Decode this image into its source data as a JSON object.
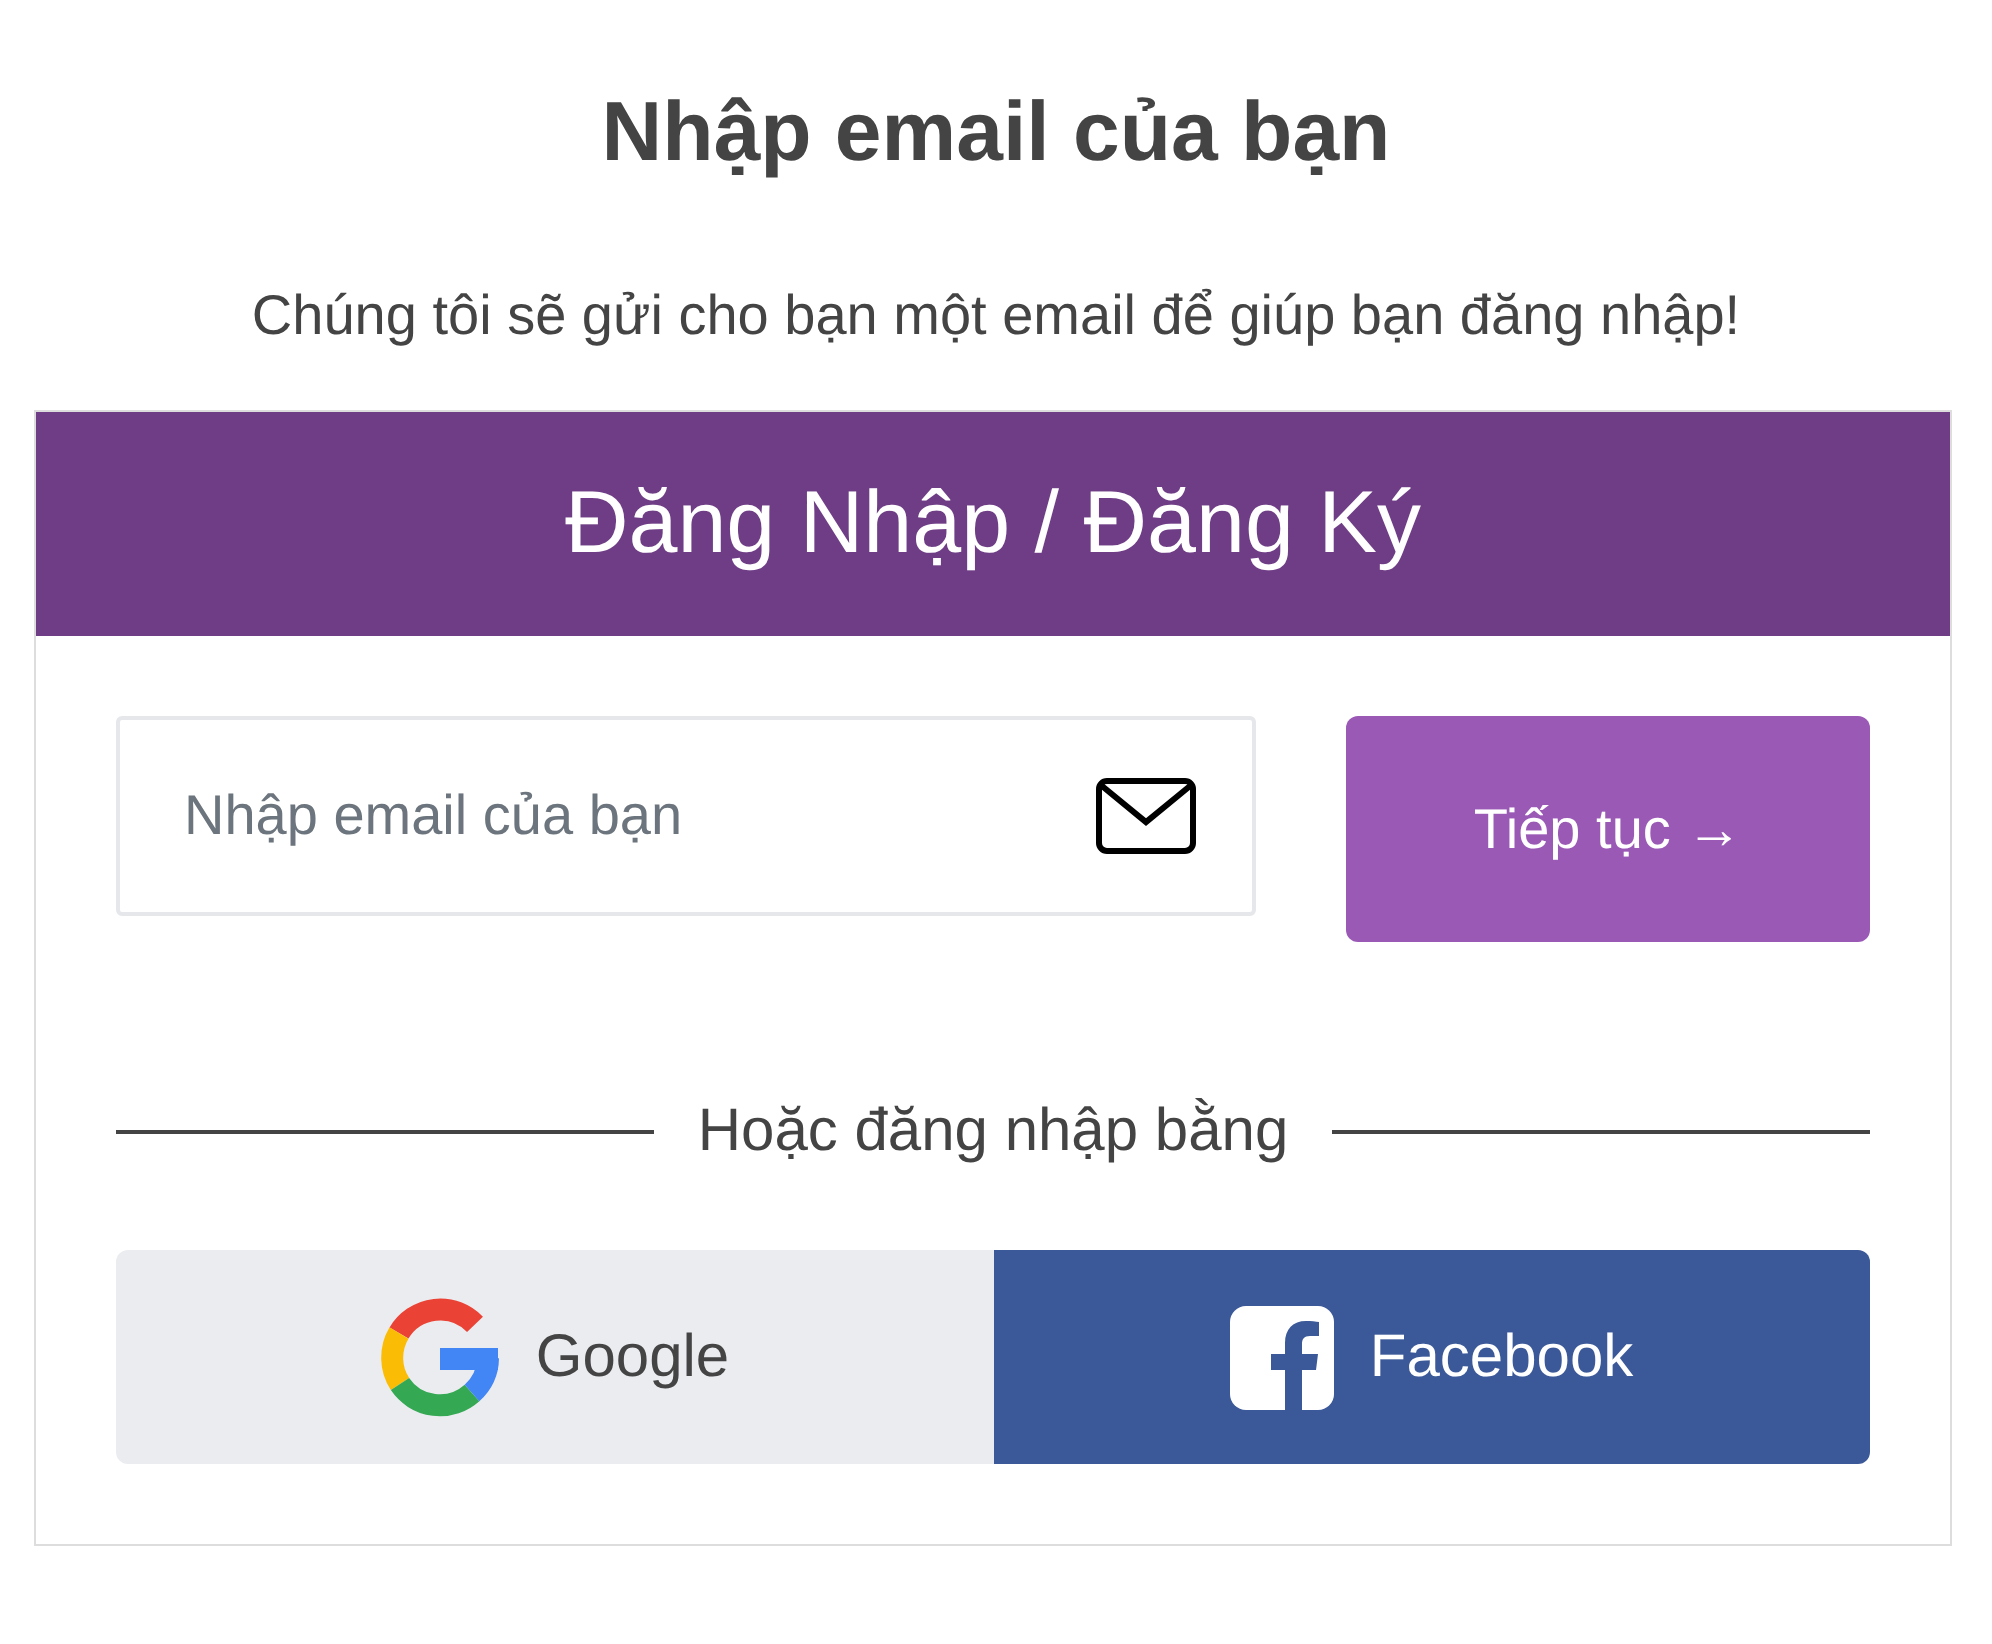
{
  "title": "Nhập email của bạn",
  "subtitle": "Chúng tôi sẽ gửi cho bạn một email để giúp bạn đăng nhập!",
  "card": {
    "header": "Đăng Nhập / Đăng Ký",
    "email_field": {
      "placeholder": "Nhập email của bạn"
    },
    "continue_button": "Tiếp tục →",
    "divider": "Hoặc đăng nhập bằng",
    "social_buttons": [
      {
        "kind": "google",
        "label": "Google"
      },
      {
        "kind": "facebook",
        "label": "Facebook"
      }
    ]
  }
}
